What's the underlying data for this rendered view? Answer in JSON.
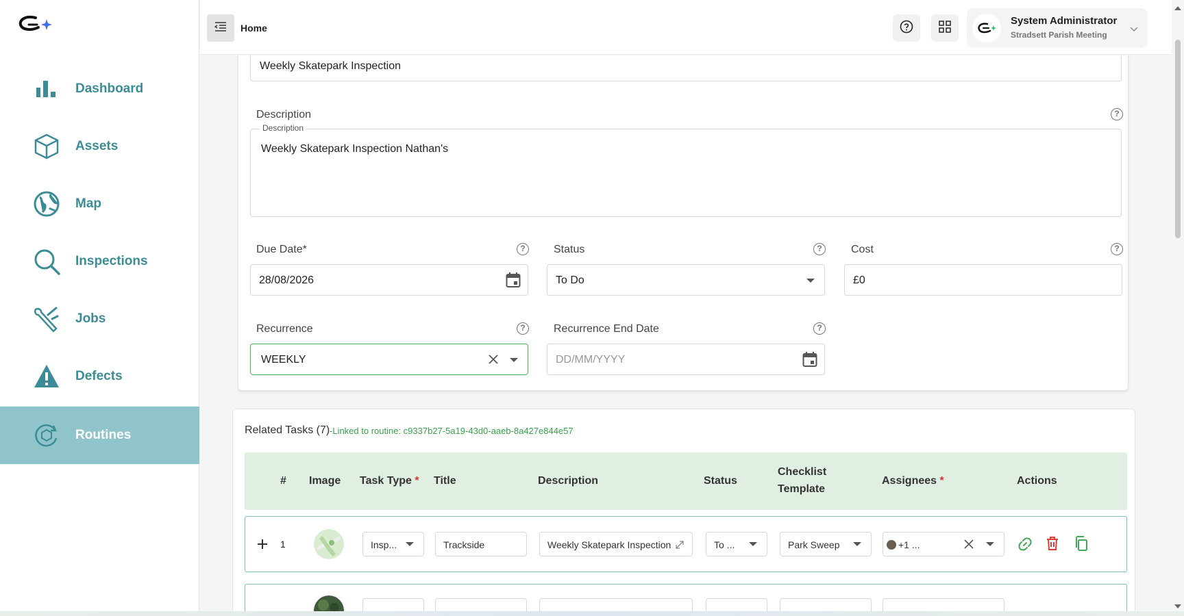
{
  "sidebar": {
    "items": [
      {
        "label": "Dashboard",
        "icon": "bar-chart-icon"
      },
      {
        "label": "Assets",
        "icon": "cube-icon"
      },
      {
        "label": "Map",
        "icon": "globe-icon"
      },
      {
        "label": "Inspections",
        "icon": "magnifier-icon"
      },
      {
        "label": "Jobs",
        "icon": "tools-icon"
      },
      {
        "label": "Defects",
        "icon": "warning-icon"
      },
      {
        "label": "Routines",
        "icon": "routine-cycle-icon",
        "active": true
      }
    ]
  },
  "header": {
    "breadcrumb": "Home",
    "user": {
      "name": "System Administrator",
      "org": "Stradsett Parish Meeting"
    }
  },
  "form": {
    "title_value": "Weekly Skatepark Inspection",
    "description_label": "Description",
    "description_legend": "Description",
    "description_value": "Weekly Skatepark Inspection Nathan's",
    "due_date_label": "Due Date*",
    "due_date_value": "28/08/2026",
    "status_label": "Status",
    "status_value": "To Do",
    "cost_label": "Cost",
    "cost_value": "£0",
    "recurrence_label": "Recurrence",
    "recurrence_value": "WEEKLY",
    "recurrence_end_label": "Recurrence End Date",
    "recurrence_end_placeholder": "DD/MM/YYYY"
  },
  "related_tasks": {
    "title": "Related Tasks (7)",
    "link": "-Linked to routine: c9337b27-5a19-43d0-aaeb-8a427e844e57",
    "columns": [
      "#",
      "Image",
      "Task Type",
      "Title",
      "Description",
      "Status",
      "Checklist",
      "Template",
      "Assignees",
      "Actions"
    ],
    "rows": [
      {
        "num": "1",
        "task_type": "Insp...",
        "title": "Trackside",
        "description": "Weekly Skatepark Inspection",
        "status": "To ...",
        "checklist": "Park Sweep",
        "assignees": "+1 ..."
      }
    ]
  },
  "colors": {
    "accent": "#3c8c98",
    "active_nav": "#8fc4cb",
    "link_green": "#3aa24a",
    "table_head": "#e1efe2",
    "danger": "#e53935"
  }
}
